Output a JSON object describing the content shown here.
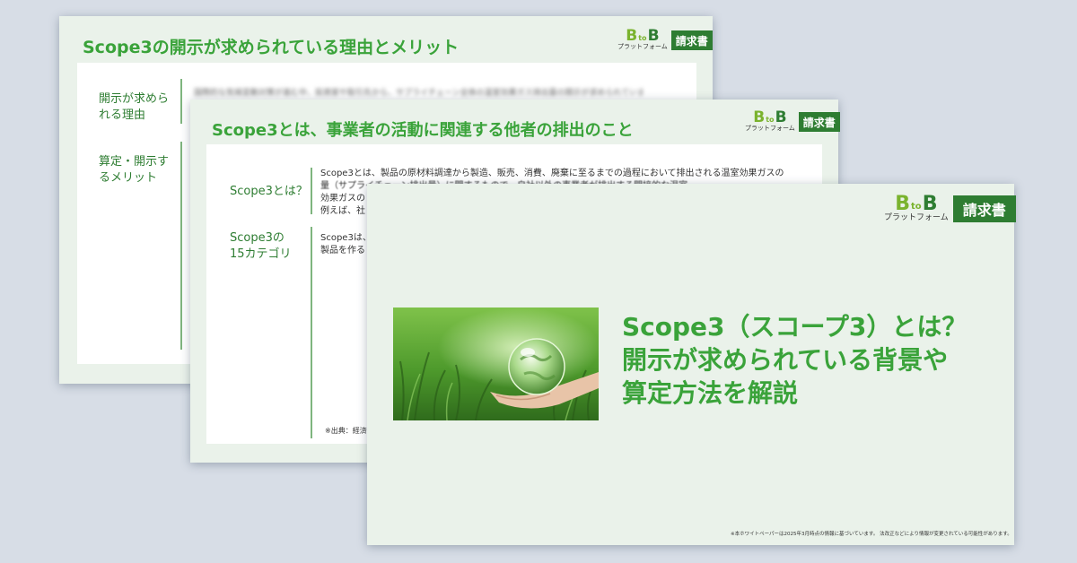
{
  "colors": {
    "background": "#d7dde6",
    "slide": "#eaf2ea",
    "accent": "#3aa33a",
    "brand_dark": "#2e7d32",
    "brand_light": "#7ab32e"
  },
  "logo": {
    "b1": "B",
    "to": "to",
    "b2": "B",
    "sub": "プラットフォーム",
    "badge": "請求書"
  },
  "slide_back": {
    "title": "Scope3の開示が求められている理由とメリット",
    "label1": "開示が求められる理由",
    "label2": "算定・開示するメリット",
    "blurred": "国際的な気候変動対策が進む中、投資家や取引先から、サプライチェーン全体の温室効果ガス排出量の開示が求められています。"
  },
  "slide_mid": {
    "title": "Scope3とは、事業者の活動に関連する他者の排出のこと",
    "label1": "Scope3とは？",
    "label2a": "Scope3の",
    "label2b": "15カテゴリ",
    "body1": "Scope3とは、製品の原材料調達から製造、販売、消費、廃棄に至るまでの過程において排出される温室効果ガスの",
    "body2": "量（サプライチェーン排出量）に関するもので、自社以外の事業者が排出する間接的な温室",
    "body3": "効果ガスの",
    "body4": "例えば、社",
    "body5": "Scope3は、",
    "body6": "製品を作る",
    "source": "※出典：経済"
  },
  "slide_front": {
    "headline": [
      "Scope3（スコープ3）とは？",
      "開示が求められている背景や",
      "算定方法を解説"
    ],
    "photo_icon": "glass-globe-in-hand-photo",
    "footnote": "※本ホワイトペーパーは2025年3月時点の情報に基づいています。 法改正などにより情報が変更されている可能性があります。"
  }
}
